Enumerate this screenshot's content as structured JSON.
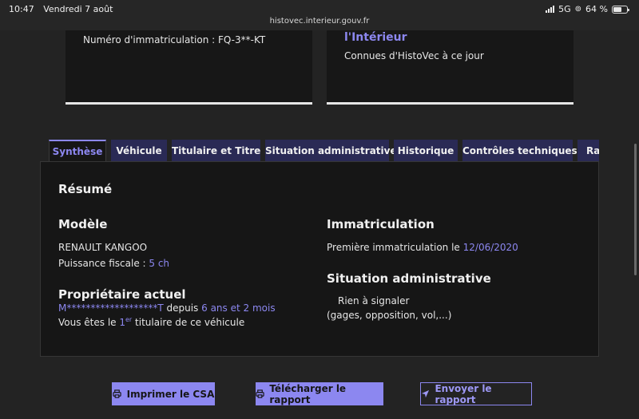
{
  "status_bar": {
    "time": "10:47",
    "date": "Vendredi 7 août",
    "url": "histovec.interieur.gouv.fr",
    "network": "5G",
    "battery": "64 %",
    "battery_level": 0.64
  },
  "top_cards": {
    "left_text": "Numéro d'immatriculation : FQ-3**-KT",
    "right_title": "l'Intérieur",
    "right_sub": "Connues d'HistoVec à ce jour"
  },
  "tabs": [
    {
      "label": "Synthèse"
    },
    {
      "label": "Véhicule"
    },
    {
      "label": "Titulaire et Titre"
    },
    {
      "label": "Situation administrative"
    },
    {
      "label": "Historique"
    },
    {
      "label": "Contrôles techniques"
    },
    {
      "label": "Rapport"
    }
  ],
  "summary": {
    "heading": "Résumé",
    "model_heading": "Modèle",
    "model_value": "RENAULT KANGOO",
    "power_label": "Puissance fiscale : ",
    "power_value": "5 ch",
    "owner_heading": "Propriétaire actuel",
    "owner_name": "M*******************T",
    "owner_since_label": " depuis ",
    "owner_since_value": "6 ans et 2 mois",
    "titulaire_prefix": "Vous êtes le ",
    "titulaire_rank": "1",
    "titulaire_sup": "er",
    "titulaire_suffix": " titulaire de ce véhicule",
    "immat_heading": "Immatriculation",
    "first_immat_label": "Première immatriculation le ",
    "first_immat_date": "12/06/2020",
    "admin_heading": "Situation administrative",
    "admin_value": "Rien à signaler",
    "admin_detail": "(gages, opposition, vol,...)"
  },
  "actions": {
    "print_label": "Imprimer le CSA",
    "download_label": "Télécharger le rapport",
    "send_label": "Envoyer le rapport"
  },
  "colors": {
    "accent": "#8c87f0",
    "tab_bg": "#2a2a55",
    "panel_bg": "#161616",
    "page_bg": "#232323"
  }
}
